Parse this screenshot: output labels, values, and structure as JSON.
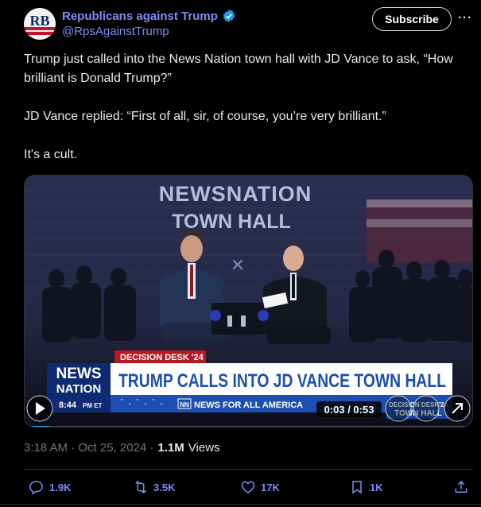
{
  "author": {
    "display_name": "Republicans against Trump",
    "handle": "@RpsAgainstTrump",
    "avatar_text": "RB"
  },
  "header": {
    "subscribe_label": "Subscribe",
    "more_label": "···"
  },
  "tweet": {
    "paragraphs": [
      "Trump just called into the News Nation town hall with JD Vance to ask, “How brilliant is Donald Trump?”",
      "JD Vance replied: “First of all, sir, of course, you’re very brilliant.”",
      "It's a cult."
    ]
  },
  "video": {
    "banner_title": "NEWSNATION",
    "banner_subtitle": "TOWN HALL",
    "desk_tag": "DECISION DESK '24",
    "headline": "TRUMP CALLS INTO JD VANCE TOWN HALL",
    "logo_top": "NEWS",
    "logo_bottom": "NATION",
    "time": "8:44",
    "time_suffix": "PM ET",
    "ticker": "NEWS FOR ALL AMERICA",
    "ticker_logo": "NN",
    "playback": "0:03 / 0:53",
    "corner_top": "DECISION DESK'24",
    "corner_bottom": "TOWN HALL",
    "progress_fraction": 0.057
  },
  "meta": {
    "time": "3:18 AM · Oct 25, 2024 ·",
    "views_count": "1.1M",
    "views_label": "Views"
  },
  "actions": {
    "replies": "1.9K",
    "reposts": "3.5K",
    "likes": "17K",
    "bookmarks": "1K"
  },
  "colors": {
    "accent": "#7f8cf5",
    "verified": "#1d9bf0",
    "headline_red": "#d4242a",
    "headline_blue": "#1c4fb0"
  }
}
